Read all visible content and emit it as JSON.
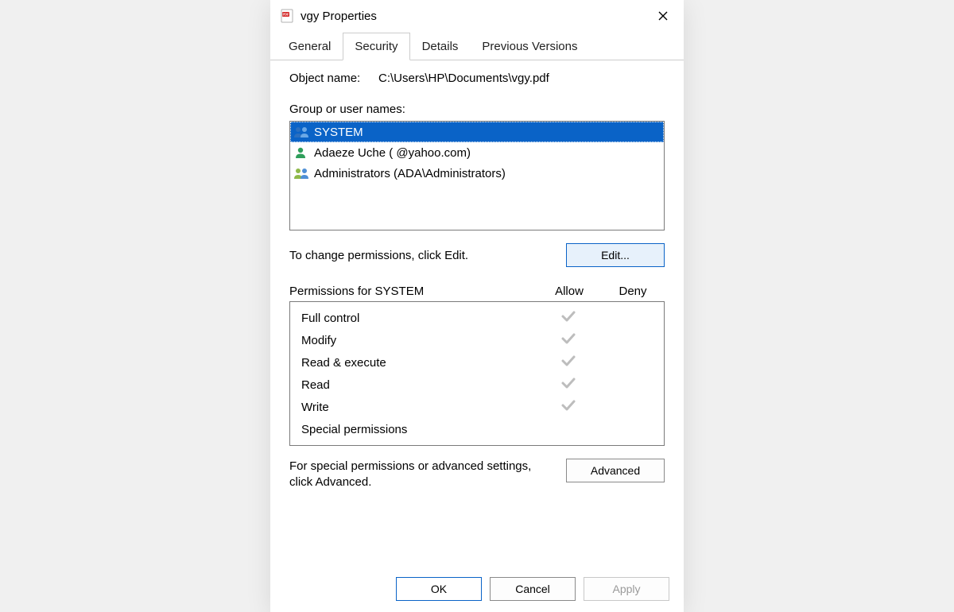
{
  "window": {
    "title": "vgy Properties"
  },
  "tabs": {
    "items": [
      {
        "label": "General",
        "active": false
      },
      {
        "label": "Security",
        "active": true
      },
      {
        "label": "Details",
        "active": false
      },
      {
        "label": "Previous Versions",
        "active": false
      }
    ]
  },
  "security": {
    "object_label": "Object name:",
    "object_path": "C:\\Users\\HP\\Documents\\vgy.pdf",
    "group_label": "Group or user names:",
    "users": [
      {
        "name": "SYSTEM",
        "selected": true,
        "icon": "two-user"
      },
      {
        "name": "Adaeze Uche (                     @yahoo.com)",
        "selected": false,
        "icon": "single-user"
      },
      {
        "name": "Administrators (ADA\\Administrators)",
        "selected": false,
        "icon": "two-user"
      }
    ],
    "edit_hint": "To change permissions, click Edit.",
    "edit_button": "Edit...",
    "perm_title": "Permissions for SYSTEM",
    "col_allow": "Allow",
    "col_deny": "Deny",
    "permissions": [
      {
        "name": "Full control",
        "allow": true,
        "deny": false
      },
      {
        "name": "Modify",
        "allow": true,
        "deny": false
      },
      {
        "name": "Read & execute",
        "allow": true,
        "deny": false
      },
      {
        "name": "Read",
        "allow": true,
        "deny": false
      },
      {
        "name": "Write",
        "allow": true,
        "deny": false
      },
      {
        "name": "Special permissions",
        "allow": false,
        "deny": false
      }
    ],
    "advanced_hint": "For special permissions or advanced settings, click Advanced.",
    "advanced_button": "Advanced"
  },
  "footer": {
    "ok": "OK",
    "cancel": "Cancel",
    "apply": "Apply"
  }
}
